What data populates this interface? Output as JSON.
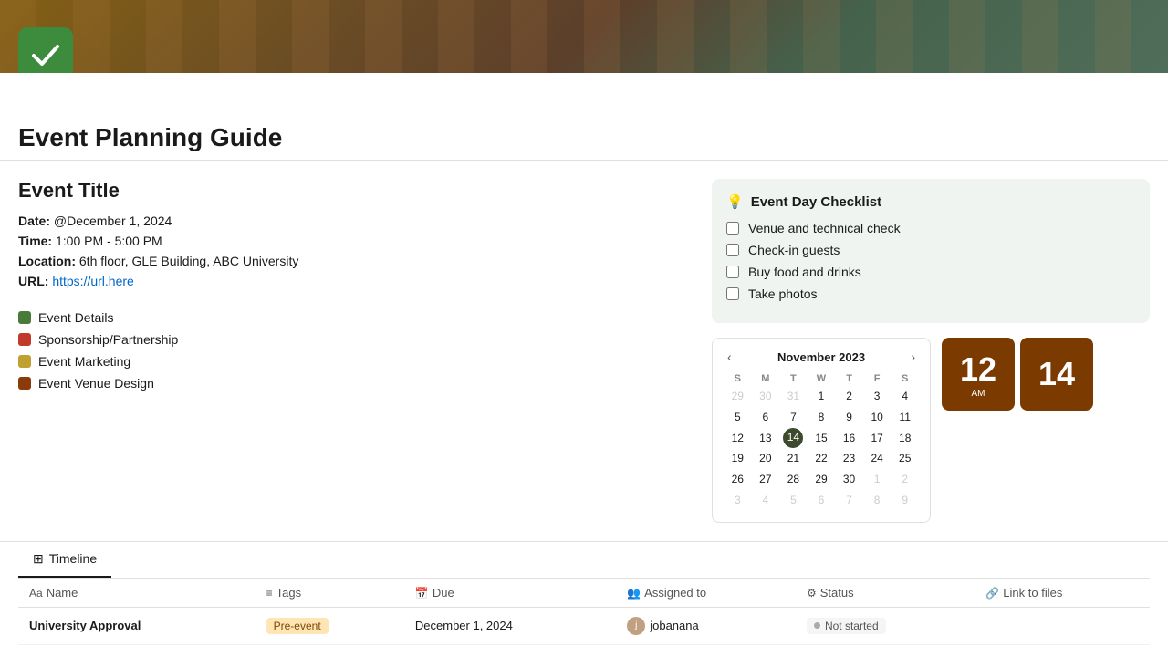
{
  "hero": {
    "alt": "Event venue background"
  },
  "logo": {
    "label": "App logo checkmark"
  },
  "page": {
    "title": "Event Planning Guide"
  },
  "event": {
    "title": "Event Title",
    "date_label": "Date:",
    "date_value": "@December 1, 2024",
    "time_label": "Time:",
    "time_value": "1:00 PM - 5:00 PM",
    "location_label": "Location:",
    "location_value": "6th floor, GLE Building, ABC University",
    "url_label": "URL:",
    "url_value": "https://url.here"
  },
  "nav": {
    "items": [
      {
        "id": "event-details",
        "label": "Event Details",
        "color": "#4a7a3a"
      },
      {
        "id": "sponsorship",
        "label": "Sponsorship/Partnership",
        "color": "#c0392b"
      },
      {
        "id": "marketing",
        "label": "Event Marketing",
        "color": "#c0a030"
      },
      {
        "id": "venue-design",
        "label": "Event Venue Design",
        "color": "#8b3a0a"
      }
    ]
  },
  "checklist": {
    "header": "Event Day Checklist",
    "icon": "💡",
    "items": [
      {
        "id": "venue-check",
        "label": "Venue and technical check",
        "checked": false
      },
      {
        "id": "check-in",
        "label": "Check-in guests",
        "checked": false
      },
      {
        "id": "food-drinks",
        "label": "Buy food and drinks",
        "checked": false
      },
      {
        "id": "photos",
        "label": "Take photos",
        "checked": false
      }
    ]
  },
  "calendar": {
    "title": "November 2023",
    "prev_label": "‹",
    "next_label": "›",
    "day_headers": [
      "S",
      "M",
      "T",
      "W",
      "T",
      "F",
      "S"
    ],
    "weeks": [
      [
        {
          "day": "29",
          "other": true
        },
        {
          "day": "30",
          "other": true
        },
        {
          "day": "31",
          "other": true
        },
        {
          "day": "1",
          "other": false
        },
        {
          "day": "2",
          "other": false
        },
        {
          "day": "3",
          "other": false
        },
        {
          "day": "4",
          "other": false
        }
      ],
      [
        {
          "day": "5",
          "other": false
        },
        {
          "day": "6",
          "other": false
        },
        {
          "day": "7",
          "other": false
        },
        {
          "day": "8",
          "other": false
        },
        {
          "day": "9",
          "other": false
        },
        {
          "day": "10",
          "other": false
        },
        {
          "day": "11",
          "other": false
        }
      ],
      [
        {
          "day": "12",
          "other": false
        },
        {
          "day": "13",
          "other": false
        },
        {
          "day": "14",
          "today": true,
          "other": false
        },
        {
          "day": "15",
          "other": false
        },
        {
          "day": "16",
          "other": false
        },
        {
          "day": "17",
          "other": false
        },
        {
          "day": "18",
          "other": false
        }
      ],
      [
        {
          "day": "19",
          "other": false
        },
        {
          "day": "20",
          "other": false
        },
        {
          "day": "21",
          "other": false
        },
        {
          "day": "22",
          "other": false
        },
        {
          "day": "23",
          "other": false
        },
        {
          "day": "24",
          "other": false
        },
        {
          "day": "25",
          "other": false
        }
      ],
      [
        {
          "day": "26",
          "other": false
        },
        {
          "day": "27",
          "other": false
        },
        {
          "day": "28",
          "other": false
        },
        {
          "day": "29",
          "other": false
        },
        {
          "day": "30",
          "other": false
        },
        {
          "day": "1",
          "other": true
        },
        {
          "day": "2",
          "other": true
        }
      ],
      [
        {
          "day": "3",
          "other": true
        },
        {
          "day": "4",
          "other": true
        },
        {
          "day": "5",
          "other": true
        },
        {
          "day": "6",
          "other": true
        },
        {
          "day": "7",
          "other": true
        },
        {
          "day": "8",
          "other": true
        },
        {
          "day": "9",
          "other": true
        }
      ]
    ]
  },
  "big_numbers": [
    {
      "number": "12",
      "label": "AM"
    },
    {
      "number": "14",
      "label": ""
    }
  ],
  "timeline": {
    "tab_label": "Timeline",
    "tab_icon": "⊞",
    "columns": [
      {
        "id": "name",
        "icon": "Aa",
        "label": "Name"
      },
      {
        "id": "tags",
        "icon": "≡",
        "label": "Tags"
      },
      {
        "id": "due",
        "icon": "📅",
        "label": "Due"
      },
      {
        "id": "assigned",
        "icon": "👥",
        "label": "Assigned to"
      },
      {
        "id": "status",
        "icon": "⚙",
        "label": "Status"
      },
      {
        "id": "files",
        "icon": "🔗",
        "label": "Link to files"
      }
    ],
    "rows": [
      {
        "name": "University Approval",
        "tag": "Pre-event",
        "tag_class": "tag-pre-event",
        "due": "December 1, 2024",
        "assigned_avatar": "j",
        "assigned_name": "jobanana",
        "status": "Not started",
        "status_class": "status-not-started",
        "files": ""
      }
    ]
  }
}
